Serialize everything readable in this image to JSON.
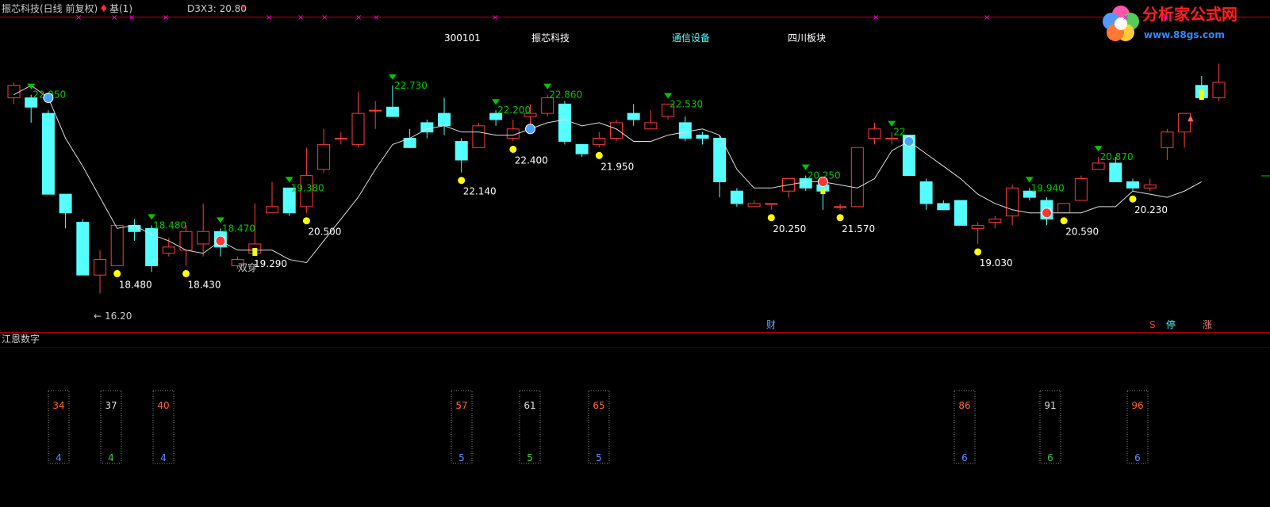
{
  "header": {
    "title": "振芯科技(日线 前复权)",
    "base_label": "基(1)",
    "indicator": "D3X3: 20.80"
  },
  "info_row": {
    "code": "300101",
    "name": "振芯科技",
    "industry": "通信设备",
    "region": "四川板块"
  },
  "watermark": {
    "text": "分析家公式网",
    "url": "www.88gs.com"
  },
  "lower_panel": {
    "title": "江恩数字"
  },
  "markers": {
    "finance": "财",
    "s": "S",
    "stop": "停",
    "rise": "涨",
    "double": "双穿"
  },
  "colors": {
    "up": "#ff3b3b",
    "down": "#55ffff",
    "green": "#00c800",
    "yellow": "#ffff00",
    "magenta": "#ff00ff",
    "border": "#c00000"
  },
  "chart_data": {
    "type": "candlestick",
    "price_range": [
      15.2,
      24.5
    ],
    "candles": [
      {
        "o": 22.5,
        "c": 22.9,
        "h": 23.0,
        "l": 22.3
      },
      {
        "o": 22.5,
        "c": 22.2,
        "h": 22.6,
        "l": 21.7
      },
      {
        "o": 22.0,
        "c": 19.4,
        "h": 22.1,
        "l": 19.4
      },
      {
        "o": 19.4,
        "c": 18.8,
        "h": 19.4,
        "l": 18.3
      },
      {
        "o": 18.5,
        "c": 16.8,
        "h": 18.6,
        "l": 16.8
      },
      {
        "o": 16.8,
        "c": 17.3,
        "h": 17.6,
        "l": 16.2
      },
      {
        "o": 17.1,
        "c": 18.4,
        "h": 18.4,
        "l": 17.1
      },
      {
        "o": 18.4,
        "c": 18.2,
        "h": 18.6,
        "l": 17.9
      },
      {
        "o": 18.3,
        "c": 17.1,
        "h": 18.4,
        "l": 16.9
      },
      {
        "o": 17.5,
        "c": 17.7,
        "h": 18.0,
        "l": 17.4
      },
      {
        "o": 17.6,
        "c": 18.2,
        "h": 18.4,
        "l": 17.1
      },
      {
        "o": 17.8,
        "c": 18.2,
        "h": 19.1,
        "l": 17.4
      },
      {
        "o": 18.2,
        "c": 17.7,
        "h": 18.3,
        "l": 17.4
      },
      {
        "o": 17.1,
        "c": 17.3,
        "h": 17.4,
        "l": 17.0
      },
      {
        "o": 17.5,
        "c": 17.8,
        "h": 19.1,
        "l": 17.5
      },
      {
        "o": 18.8,
        "c": 19.0,
        "h": 19.8,
        "l": 18.8
      },
      {
        "o": 19.6,
        "c": 18.8,
        "h": 19.6,
        "l": 18.7
      },
      {
        "o": 19.0,
        "c": 20.0,
        "h": 20.9,
        "l": 18.8
      },
      {
        "o": 20.2,
        "c": 21.0,
        "h": 21.5,
        "l": 20.1
      },
      {
        "o": 21.2,
        "c": 21.2,
        "h": 21.4,
        "l": 21.0
      },
      {
        "o": 21.0,
        "c": 22.0,
        "h": 22.7,
        "l": 20.9
      },
      {
        "o": 22.1,
        "c": 22.1,
        "h": 22.4,
        "l": 21.5
      },
      {
        "o": 22.2,
        "c": 21.9,
        "h": 22.9,
        "l": 21.9
      },
      {
        "o": 21.2,
        "c": 20.9,
        "h": 21.5,
        "l": 20.9
      },
      {
        "o": 21.7,
        "c": 21.4,
        "h": 21.8,
        "l": 21.2
      },
      {
        "o": 22.0,
        "c": 21.6,
        "h": 22.5,
        "l": 21.3
      },
      {
        "o": 21.1,
        "c": 20.5,
        "h": 21.2,
        "l": 20.1
      },
      {
        "o": 20.9,
        "c": 21.6,
        "h": 21.7,
        "l": 20.9
      },
      {
        "o": 22.0,
        "c": 21.8,
        "h": 22.1,
        "l": 21.6
      },
      {
        "o": 21.2,
        "c": 21.5,
        "h": 21.8,
        "l": 21.1
      },
      {
        "o": 21.9,
        "c": 22.0,
        "h": 22.3,
        "l": 21.6
      },
      {
        "o": 22.0,
        "c": 22.5,
        "h": 22.6,
        "l": 21.9
      },
      {
        "o": 22.3,
        "c": 21.1,
        "h": 22.4,
        "l": 21.0
      },
      {
        "o": 21.0,
        "c": 20.7,
        "h": 21.0,
        "l": 20.6
      },
      {
        "o": 21.0,
        "c": 21.2,
        "h": 21.4,
        "l": 20.9
      },
      {
        "o": 21.2,
        "c": 21.7,
        "h": 21.8,
        "l": 21.1
      },
      {
        "o": 22.0,
        "c": 21.8,
        "h": 22.3,
        "l": 21.6
      },
      {
        "o": 21.5,
        "c": 21.7,
        "h": 22.1,
        "l": 21.5
      },
      {
        "o": 21.9,
        "c": 22.3,
        "h": 22.3,
        "l": 21.8
      },
      {
        "o": 21.7,
        "c": 21.2,
        "h": 21.9,
        "l": 21.1
      },
      {
        "o": 21.3,
        "c": 21.2,
        "h": 21.4,
        "l": 21.0
      },
      {
        "o": 21.2,
        "c": 19.8,
        "h": 21.3,
        "l": 19.3
      },
      {
        "o": 19.5,
        "c": 19.1,
        "h": 19.6,
        "l": 19.0
      },
      {
        "o": 19.0,
        "c": 19.1,
        "h": 19.2,
        "l": 19.0
      },
      {
        "o": 19.1,
        "c": 19.1,
        "h": 19.1,
        "l": 18.9
      },
      {
        "o": 19.5,
        "c": 19.9,
        "h": 19.9,
        "l": 19.3
      },
      {
        "o": 19.9,
        "c": 19.6,
        "h": 20.0,
        "l": 19.5
      },
      {
        "o": 19.7,
        "c": 19.5,
        "h": 19.7,
        "l": 18.9
      },
      {
        "o": 19.0,
        "c": 19.0,
        "h": 19.1,
        "l": 18.9
      },
      {
        "o": 19.0,
        "c": 20.9,
        "h": 20.9,
        "l": 19.0
      },
      {
        "o": 21.2,
        "c": 21.5,
        "h": 21.7,
        "l": 21.0
      },
      {
        "o": 21.2,
        "c": 21.2,
        "h": 21.4,
        "l": 21.0
      },
      {
        "o": 21.3,
        "c": 20.0,
        "h": 21.3,
        "l": 20.0
      },
      {
        "o": 19.8,
        "c": 19.1,
        "h": 19.9,
        "l": 18.9
      },
      {
        "o": 19.1,
        "c": 18.9,
        "h": 19.2,
        "l": 18.9
      },
      {
        "o": 19.2,
        "c": 18.4,
        "h": 19.2,
        "l": 18.4
      },
      {
        "o": 18.3,
        "c": 18.4,
        "h": 18.5,
        "l": 17.8
      },
      {
        "o": 18.5,
        "c": 18.6,
        "h": 18.7,
        "l": 18.3
      },
      {
        "o": 18.7,
        "c": 19.6,
        "h": 19.7,
        "l": 18.4
      },
      {
        "o": 19.5,
        "c": 19.3,
        "h": 19.6,
        "l": 19.2
      },
      {
        "o": 19.2,
        "c": 18.6,
        "h": 19.3,
        "l": 18.4
      },
      {
        "o": 18.8,
        "c": 19.1,
        "h": 19.1,
        "l": 18.8
      },
      {
        "o": 19.2,
        "c": 19.9,
        "h": 20.0,
        "l": 19.2
      },
      {
        "o": 20.2,
        "c": 20.4,
        "h": 20.6,
        "l": 20.2
      },
      {
        "o": 20.4,
        "c": 19.8,
        "h": 20.6,
        "l": 19.8
      },
      {
        "o": 19.8,
        "c": 19.6,
        "h": 19.9,
        "l": 19.5
      },
      {
        "o": 19.6,
        "c": 19.7,
        "h": 19.9,
        "l": 19.5
      },
      {
        "o": 20.9,
        "c": 21.4,
        "h": 21.5,
        "l": 20.5
      },
      {
        "o": 21.4,
        "c": 22.0,
        "h": 22.0,
        "l": 20.9
      },
      {
        "o": 22.9,
        "c": 22.5,
        "h": 23.2,
        "l": 22.5
      },
      {
        "o": 22.5,
        "c": 23.0,
        "h": 23.6,
        "l": 22.4
      }
    ],
    "line_values": [
      22.6,
      22.9,
      22.5,
      21.2,
      20.3,
      19.3,
      18.3,
      18.4,
      18.1,
      17.9,
      17.6,
      17.5,
      17.9,
      17.6,
      17.6,
      17.6,
      17.3,
      17.2,
      17.9,
      18.6,
      19.3,
      20.2,
      21.0,
      21.2,
      21.5,
      21.6,
      21.4,
      21.4,
      21.3,
      21.3,
      21.5,
      21.7,
      21.8,
      21.6,
      21.7,
      21.5,
      21.1,
      21.1,
      21.3,
      21.4,
      21.5,
      21.3,
      20.2,
      19.6,
      19.6,
      19.7,
      19.8,
      19.8,
      19.7,
      19.6,
      19.9,
      20.8,
      21.1,
      20.7,
      20.3,
      19.9,
      19.4,
      19.1,
      18.9,
      18.8,
      18.8,
      18.8,
      18.8,
      19.0,
      19.0,
      19.5,
      19.4,
      19.3,
      19.5,
      19.8
    ],
    "yellow_bars": [
      14,
      47,
      69
    ],
    "sell_triangles": [
      {
        "i": 1,
        "label": "22.950"
      },
      {
        "i": 8,
        "label": "18.480"
      },
      {
        "i": 12,
        "label": "18.470"
      },
      {
        "i": 16,
        "label": "19.380"
      },
      {
        "i": 22,
        "label": "22.730"
      },
      {
        "i": 28,
        "label": "22.200"
      },
      {
        "i": 31,
        "label": "22.860"
      },
      {
        "i": 38,
        "label": "22.530"
      },
      {
        "i": 46,
        "label": "20.250"
      },
      {
        "i": 51,
        "label": "22"
      },
      {
        "i": 59,
        "label": "19.940"
      },
      {
        "i": 63,
        "label": "20.870"
      }
    ],
    "buy_dots": [
      {
        "i": 6,
        "label": "18.480"
      },
      {
        "i": 10,
        "label": "18.430"
      },
      {
        "i": 17,
        "label": "20.500"
      },
      {
        "i": 26,
        "label": "22.140"
      },
      {
        "i": 29,
        "label": "22.400"
      },
      {
        "i": 34,
        "label": "21.950"
      },
      {
        "i": 44,
        "label": "20.250"
      },
      {
        "i": 48,
        "label": "21.570"
      },
      {
        "i": 56,
        "label": "19.030"
      },
      {
        "i": 61,
        "label": "20.590"
      },
      {
        "i": 65,
        "label": "20.230"
      }
    ],
    "low_marker": "16.20",
    "low_label_extra": "19.290",
    "gann_columns": [
      {
        "top": "34",
        "bottom": "4",
        "top_color": "#ff6633",
        "bottom_color": "#6688ff"
      },
      {
        "top": "37",
        "bottom": "4",
        "top_color": "#dddddd",
        "bottom_color": "#44cc44"
      },
      {
        "top": "40",
        "bottom": "4",
        "top_color": "#ff6633",
        "bottom_color": "#6688ff"
      },
      {
        "top": "57",
        "bottom": "5",
        "top_color": "#ff6633",
        "bottom_color": "#6688ff"
      },
      {
        "top": "61",
        "bottom": "5",
        "top_color": "#dddddd",
        "bottom_color": "#44cc44"
      },
      {
        "top": "65",
        "bottom": "5",
        "top_color": "#ff6633",
        "bottom_color": "#6688ff"
      },
      {
        "top": "86",
        "bottom": "6",
        "top_color": "#ff6633",
        "bottom_color": "#6688ff"
      },
      {
        "top": "91",
        "bottom": "6",
        "top_color": "#dddddd",
        "bottom_color": "#44cc44"
      },
      {
        "top": "96",
        "bottom": "6",
        "top_color": "#ff6633",
        "bottom_color": "#6688ff"
      }
    ]
  }
}
